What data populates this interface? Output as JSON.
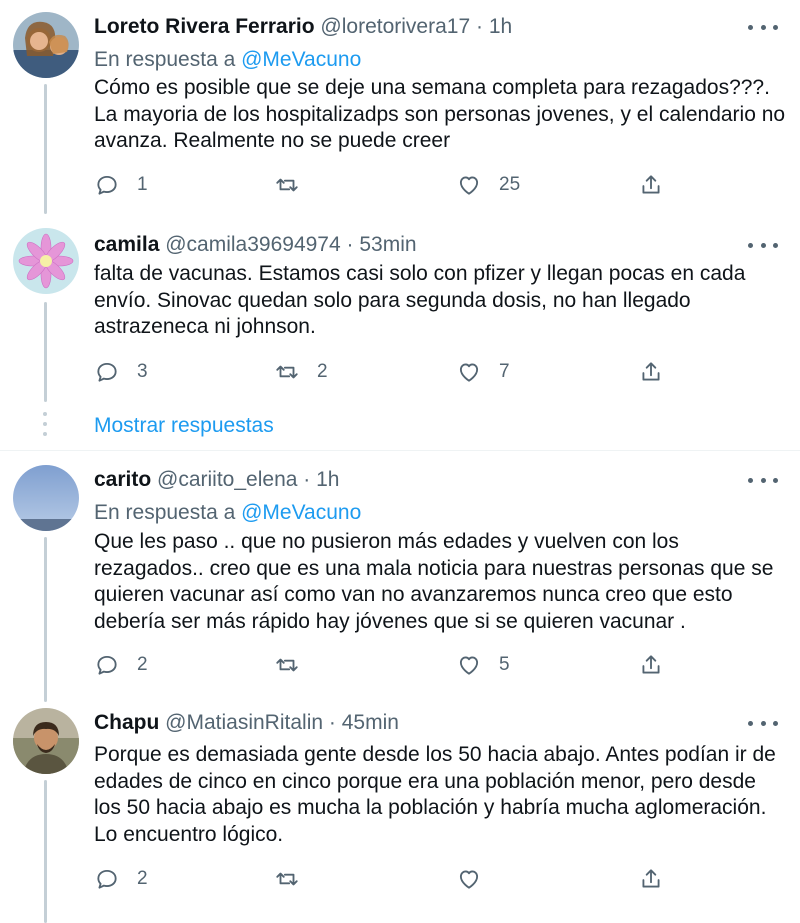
{
  "tweets": [
    {
      "name": "Loreto Rivera Ferrario",
      "handle": "@loretorivera17",
      "time": "1h",
      "reply_prefix": "En respuesta a",
      "reply_mention": "@MeVacuno",
      "lines": [
        "Cómo es posible que se deje una semana completa para rezagados???.",
        "La mayoria de los hospitalizadps son personas jovenes, y el calendario no",
        "avanza. Realmente no se puede creer"
      ],
      "replies": "1",
      "retweets": "",
      "likes": "25"
    },
    {
      "name": "camila",
      "handle": "@camila39694974",
      "time": "53min",
      "lines": [
        "falta de vacunas. Estamos casi solo con pfizer y llegan pocas en cada",
        "envío. Sinovac quedan solo para segunda dosis, no han llegado",
        "astrazeneca ni johnson."
      ],
      "replies": "3",
      "retweets": "2",
      "likes": "7"
    },
    {
      "name": "carito",
      "handle": "@cariito_elena",
      "time": "1h",
      "reply_prefix": "En respuesta a",
      "reply_mention": "@MeVacuno",
      "lines": [
        "Que les paso .. que no pusieron más edades y vuelven con los",
        "rezagados.. creo que es una mala noticia para nuestras personas que se",
        "quieren vacunar así como van no avanzaremos nunca creo que esto",
        "debería ser más rápido hay jóvenes que si se quieren vacunar ."
      ],
      "replies": "2",
      "retweets": "",
      "likes": "5"
    },
    {
      "name": "Chapu",
      "handle": "@MatiasinRitalin",
      "time": "45min",
      "lines": [
        "Porque es demasiada gente desde los 50 hacia abajo. Antes podían ir de",
        "edades de cinco en cinco porque era una población menor, pero desde",
        "los 50 hacia abajo es mucha la población y habría mucha aglomeración.",
        "Lo encuentro lógico."
      ],
      "replies": "2",
      "retweets": "",
      "likes": ""
    }
  ],
  "show_replies_label": "Mostrar respuestas",
  "separator": "·",
  "icons": {
    "reply": "reply-icon",
    "retweet": "retweet-icon",
    "like": "heart-icon",
    "share": "share-icon",
    "more": "more-icon"
  },
  "colors": {
    "accent": "#1d9bf0",
    "secondary_text": "#536471",
    "thread_line": "#c4cfd6"
  }
}
